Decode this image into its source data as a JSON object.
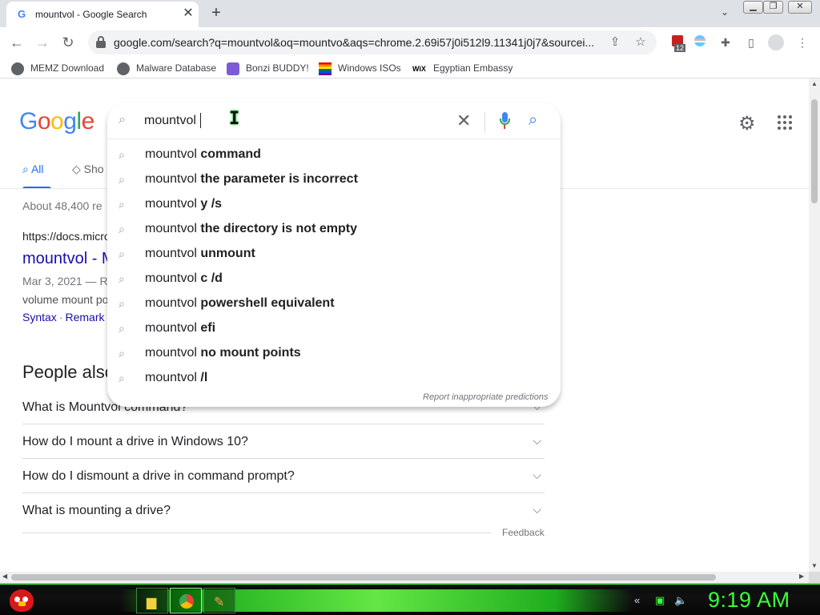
{
  "browser": {
    "tab_title": "mountvol - Google Search",
    "tab_favicon": "G",
    "tab_close": "✕",
    "new_tab": "+",
    "url": "google.com/search?q=mountvol&oq=mountvo&aqs=chrome.2.69i57j0i512l9.11341j0j7&sourcei...",
    "extension_badge": "12"
  },
  "bookmarks": [
    {
      "label": "MEMZ Download",
      "icon": "globe-icon"
    },
    {
      "label": "Malware Database",
      "icon": "globe-icon"
    },
    {
      "label": "Bonzi BUDDY!",
      "icon": "bonzi-icon"
    },
    {
      "label": "Windows ISOs",
      "icon": "rainbow-flag-icon"
    },
    {
      "label": "Egyptian Embassy",
      "icon": "wix-icon",
      "icon_text": "WiX"
    }
  ],
  "google": {
    "logo": [
      "G",
      "o",
      "o",
      "g",
      "l",
      "e"
    ],
    "logo_colors": [
      "#4285f4",
      "#ea4335",
      "#fbbc05",
      "#4285f4",
      "#34a853",
      "#ea4335"
    ],
    "query": "mountvol",
    "suggestions": [
      {
        "prefix": "mountvol",
        "bold": "command"
      },
      {
        "prefix": "mountvol",
        "bold": "the parameter is incorrect"
      },
      {
        "prefix": "mountvol",
        "bold": "y /s"
      },
      {
        "prefix": "mountvol",
        "bold": "the directory is not empty"
      },
      {
        "prefix": "mountvol",
        "bold": "unmount"
      },
      {
        "prefix": "mountvol",
        "bold": "c /d"
      },
      {
        "prefix": "mountvol",
        "bold": "powershell equivalent"
      },
      {
        "prefix": "mountvol",
        "bold": "efi"
      },
      {
        "prefix": "mountvol",
        "bold": "no mount points"
      },
      {
        "prefix": "mountvol",
        "bold": "/l"
      }
    ],
    "report_text": "Report inappropriate predictions",
    "tab_all": "All",
    "tab_shopping": "Sho",
    "result_stats": "About 48,400 re",
    "result": {
      "cite": "https://docs.micro",
      "title": "mountvol - M",
      "date": "Mar 3, 2021 — R",
      "snippet": "volume mount po",
      "link1": "Syntax",
      "link2": "Remark"
    },
    "paa_title": "People also",
    "paa": [
      "What is Mountvol command?",
      "How do I mount a drive in Windows 10?",
      "How do I dismount a drive in command prompt?",
      "What is mounting a drive?"
    ],
    "feedback": "Feedback"
  },
  "taskbar": {
    "clock": "9:19 AM"
  },
  "colors": {
    "accent_blue": "#1a73e8",
    "link": "#1a0dab",
    "taskbar_green": "#39ff39"
  }
}
